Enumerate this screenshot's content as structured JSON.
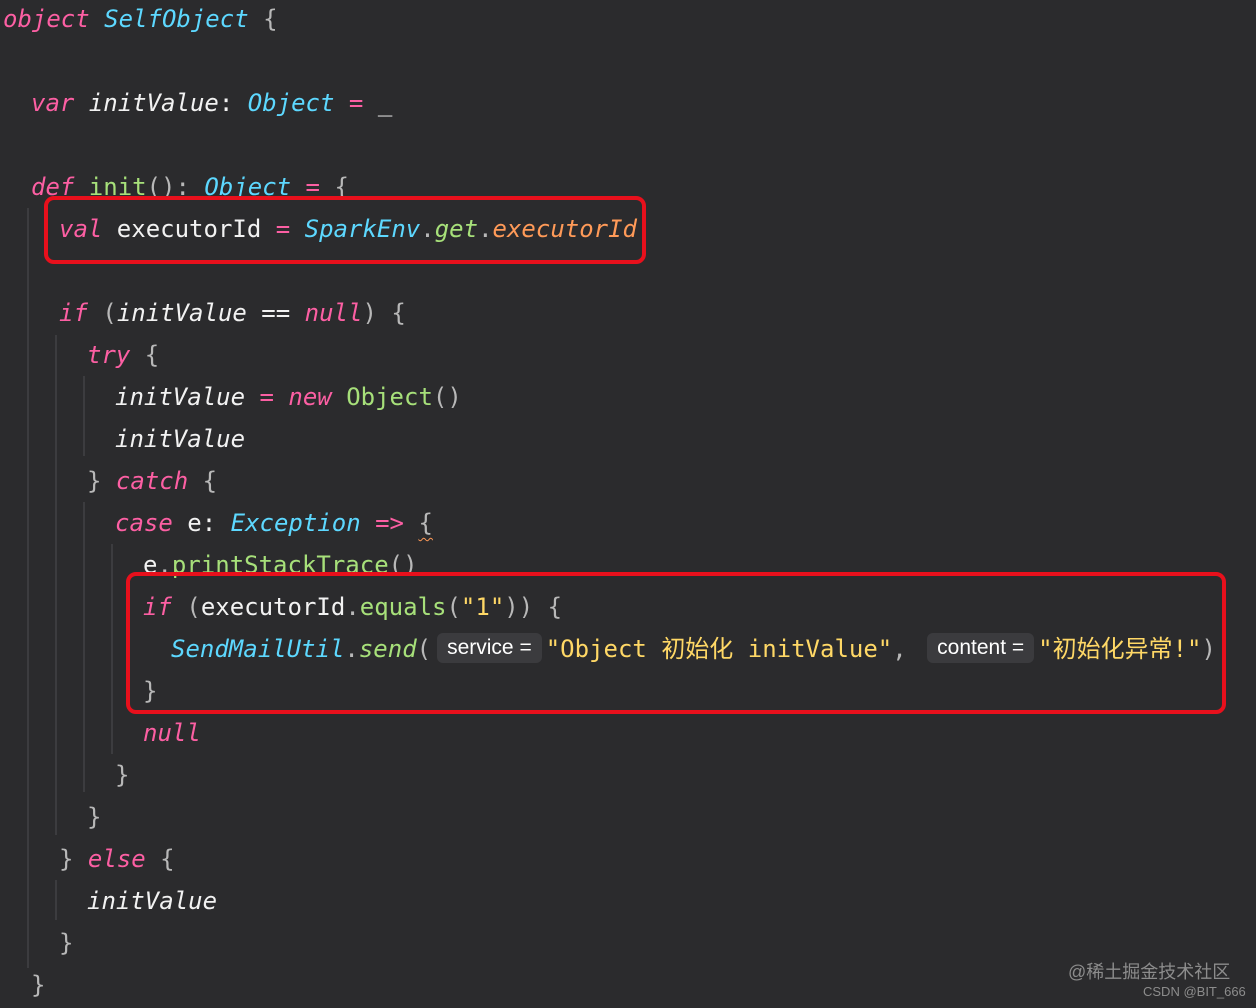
{
  "watermark": {
    "site": "@稀土掘金技术社区",
    "credit": "CSDN @BIT_666"
  },
  "code": {
    "lines": [
      {
        "tokens": [
          {
            "t": "object ",
            "c": "kw"
          },
          {
            "t": "SelfObject",
            "c": "ty"
          },
          {
            "t": " {",
            "c": "punc"
          }
        ]
      },
      {
        "tokens": []
      },
      {
        "tokens": [
          {
            "t": "var ",
            "c": "kw"
          },
          {
            "t": "initValue",
            "c": "idi"
          },
          {
            "t": ": ",
            "c": "id"
          },
          {
            "t": "Object",
            "c": "ty"
          },
          {
            "t": " = ",
            "c": "op"
          },
          {
            "t": "_",
            "c": "id"
          }
        ]
      },
      {
        "tokens": []
      },
      {
        "tokens": [
          {
            "t": "def ",
            "c": "kw"
          },
          {
            "t": "init",
            "c": "fn"
          },
          {
            "t": "(): ",
            "c": "punc"
          },
          {
            "t": "Object",
            "c": "ty"
          },
          {
            "t": " = ",
            "c": "op"
          },
          {
            "t": "{",
            "c": "punc"
          }
        ]
      },
      {
        "tokens": [
          {
            "t": "val ",
            "c": "kw"
          },
          {
            "t": "executorId",
            "c": "id"
          },
          {
            "t": " = ",
            "c": "op"
          },
          {
            "t": "SparkEnv",
            "c": "ty"
          },
          {
            "t": ".",
            "c": "punc"
          },
          {
            "t": "get",
            "c": "fni"
          },
          {
            "t": ".",
            "c": "punc"
          },
          {
            "t": "executorId",
            "c": "prop"
          }
        ]
      },
      {
        "tokens": []
      },
      {
        "tokens": [
          {
            "t": "if ",
            "c": "kw"
          },
          {
            "t": "(",
            "c": "punc"
          },
          {
            "t": "initValue",
            "c": "idi"
          },
          {
            "t": " == ",
            "c": "id"
          },
          {
            "t": "null",
            "c": "kw"
          },
          {
            "t": ") {",
            "c": "punc"
          }
        ]
      },
      {
        "tokens": [
          {
            "t": "try ",
            "c": "kw"
          },
          {
            "t": "{",
            "c": "punc"
          }
        ]
      },
      {
        "tokens": [
          {
            "t": "initValue",
            "c": "idi"
          },
          {
            "t": " = ",
            "c": "op"
          },
          {
            "t": "new ",
            "c": "kw"
          },
          {
            "t": "Object",
            "c": "cls"
          },
          {
            "t": "()",
            "c": "punc"
          }
        ]
      },
      {
        "tokens": [
          {
            "t": "initValue",
            "c": "idi"
          }
        ]
      },
      {
        "tokens": [
          {
            "t": "} ",
            "c": "punc"
          },
          {
            "t": "catch ",
            "c": "kw"
          },
          {
            "t": "{",
            "c": "punc"
          }
        ]
      },
      {
        "tokens": [
          {
            "t": "case ",
            "c": "kw"
          },
          {
            "t": "e: ",
            "c": "id"
          },
          {
            "t": "Exception",
            "c": "ty"
          },
          {
            "t": " => ",
            "c": "op"
          },
          {
            "t": "{",
            "c": "punc squig"
          }
        ]
      },
      {
        "tokens": [
          {
            "t": "e",
            "c": "id"
          },
          {
            "t": ".",
            "c": "punc"
          },
          {
            "t": "printStackTrace",
            "c": "fn"
          },
          {
            "t": "()",
            "c": "punc"
          }
        ]
      },
      {
        "tokens": [
          {
            "t": "if ",
            "c": "kw"
          },
          {
            "t": "(",
            "c": "punc"
          },
          {
            "t": "executorId",
            "c": "id"
          },
          {
            "t": ".",
            "c": "punc"
          },
          {
            "t": "equals",
            "c": "fn"
          },
          {
            "t": "(",
            "c": "punc"
          },
          {
            "t": "\"1\"",
            "c": "str"
          },
          {
            "t": ")) {",
            "c": "punc"
          }
        ]
      },
      {
        "tokens": [
          {
            "t": "SendMailUtil",
            "c": "ty"
          },
          {
            "t": ".",
            "c": "punc"
          },
          {
            "t": "send",
            "c": "fni"
          },
          {
            "t": "(",
            "c": "punc"
          },
          {
            "t": "service =",
            "c": "hint"
          },
          {
            "t": "\"Object 初始化 initValue\"",
            "c": "str"
          },
          {
            "t": ", ",
            "c": "punc"
          },
          {
            "t": "content =",
            "c": "hint"
          },
          {
            "t": "\"初始化异常!\"",
            "c": "str"
          },
          {
            "t": ")",
            "c": "punc"
          }
        ]
      },
      {
        "tokens": [
          {
            "t": "}",
            "c": "punc"
          }
        ]
      },
      {
        "tokens": [
          {
            "t": "null",
            "c": "kw"
          }
        ]
      },
      {
        "tokens": [
          {
            "t": "}",
            "c": "punc"
          }
        ]
      },
      {
        "tokens": [
          {
            "t": "}",
            "c": "punc"
          }
        ]
      },
      {
        "tokens": [
          {
            "t": "} ",
            "c": "punc"
          },
          {
            "t": "else ",
            "c": "kw"
          },
          {
            "t": "{",
            "c": "punc"
          }
        ]
      },
      {
        "tokens": [
          {
            "t": "initValue",
            "c": "idi"
          }
        ]
      },
      {
        "tokens": [
          {
            "t": "}",
            "c": "punc"
          }
        ]
      },
      {
        "tokens": [
          {
            "t": "}",
            "c": "punc"
          }
        ]
      }
    ]
  }
}
